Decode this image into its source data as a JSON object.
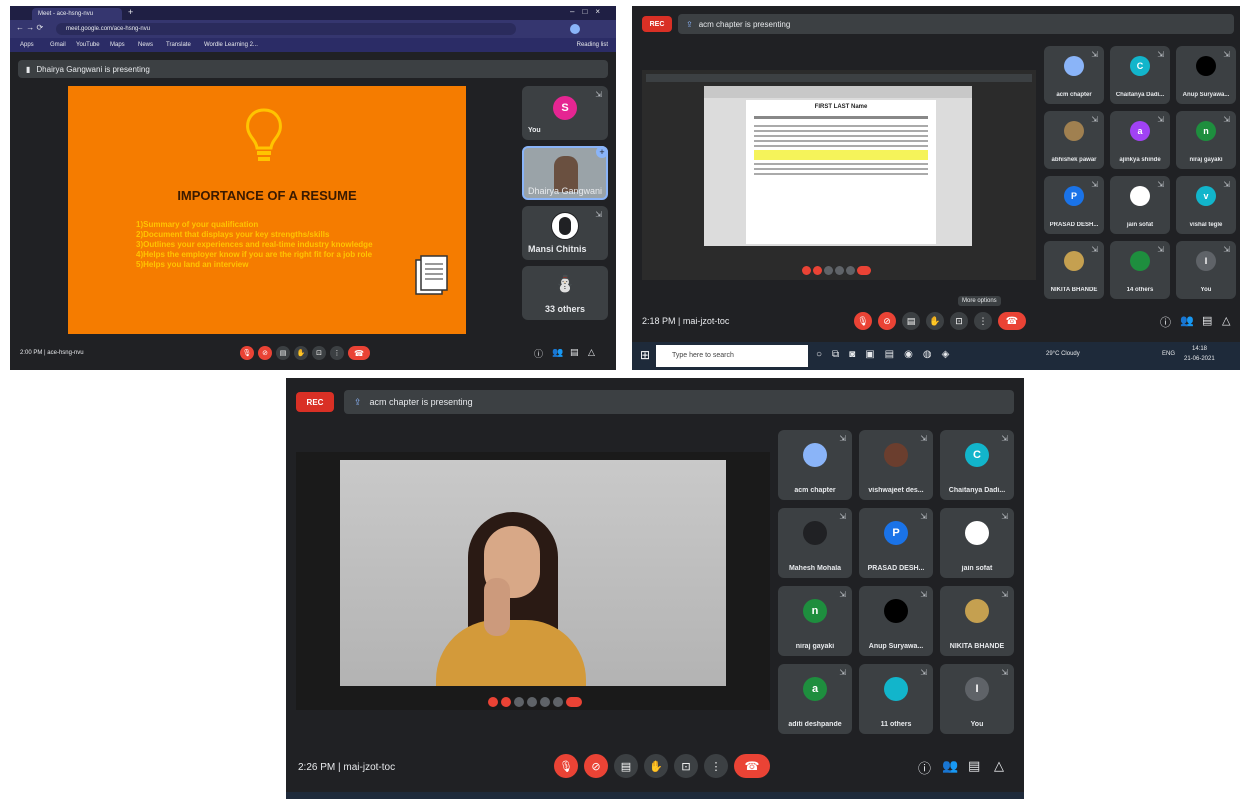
{
  "shot1": {
    "browser_tab": "Meet - ace-hsng-nvu",
    "url": "meet.google.com/ace-hsng-nvu",
    "bookmarks": [
      "Apps",
      "Gmail",
      "YouTube",
      "Maps",
      "News",
      "Translate",
      "Wordle Learning 2..."
    ],
    "reading_list": "Reading list",
    "presenter_banner": "Dhairya Gangwani is presenting",
    "slide": {
      "title": "IMPORTANCE OF A RESUME",
      "points": [
        "1)Summary of your qualification",
        "2)Document that displays your key strengths/skills",
        "3)Outlines your experiences and real-time industry knowledge",
        "4)Helps the employer know if you are the right fit for a job role",
        "5)Helps you land an interview"
      ]
    },
    "tiles": [
      {
        "name": "You",
        "initial": "S",
        "color": "#e52592"
      },
      {
        "name": "Dhairya Gangwani",
        "initial": "",
        "color": "#5f6368"
      },
      {
        "name": "Mansi Chitnis",
        "initial": "",
        "color": "#ffffff"
      },
      {
        "name": "33 others",
        "initial": "",
        "color": "#8ab4f8"
      }
    ],
    "time": "2:00 PM",
    "meeting_code": "ace-hsng-nvu"
  },
  "shot2": {
    "rec": "REC",
    "presenting": "acm chapter is presenting",
    "doc_title": "FIRST LAST Name",
    "tiles": [
      {
        "name": "acm chapter",
        "initial": "",
        "color": "#8ab4f8"
      },
      {
        "name": "Chaitanya Dadi...",
        "initial": "C",
        "color": "#12b5cb"
      },
      {
        "name": "Anup Suryawa...",
        "initial": "",
        "color": "#000000"
      },
      {
        "name": "abhishek pawar",
        "initial": "",
        "color": "#a08050"
      },
      {
        "name": "ajinkya shinde",
        "initial": "a",
        "color": "#a142f4"
      },
      {
        "name": "niraj gayaki",
        "initial": "n",
        "color": "#1e8e3e"
      },
      {
        "name": "PRASAD DESH...",
        "initial": "P",
        "color": "#1a73e8"
      },
      {
        "name": "jain sofat",
        "initial": "",
        "color": "#ffffff"
      },
      {
        "name": "vishal tegle",
        "initial": "v",
        "color": "#12b5cb"
      },
      {
        "name": "NIKITA BHANDE",
        "initial": "",
        "color": "#c5a050"
      },
      {
        "name": "14 others",
        "initial": "",
        "color": "#1e8e3e"
      },
      {
        "name": "You",
        "initial": "I",
        "color": "#5f6368"
      }
    ],
    "tooltip": "More options",
    "time": "2:18 PM",
    "meeting_code": "mai-jzot-toc",
    "taskbar_search": "Type here to search",
    "weather": "29°C Cloudy",
    "clock": "14:18",
    "date": "21-06-2021",
    "lang": "ENG"
  },
  "shot3": {
    "rec": "REC",
    "presenting": "acm chapter is presenting",
    "tiles": [
      {
        "name": "acm chapter",
        "initial": "",
        "color": "#8ab4f8"
      },
      {
        "name": "vishwajeet des...",
        "initial": "",
        "color": "#6b3e2e"
      },
      {
        "name": "Chaitanya Dadi...",
        "initial": "C",
        "color": "#12b5cb"
      },
      {
        "name": "Mahesh Mohala",
        "initial": "",
        "color": "#202124"
      },
      {
        "name": "PRASAD DESH...",
        "initial": "P",
        "color": "#1a73e8"
      },
      {
        "name": "jain sofat",
        "initial": "",
        "color": "#ffffff"
      },
      {
        "name": "niraj gayaki",
        "initial": "n",
        "color": "#1e8e3e"
      },
      {
        "name": "Anup Suryawa...",
        "initial": "",
        "color": "#000000"
      },
      {
        "name": "NIKITA BHANDE",
        "initial": "",
        "color": "#c5a050"
      },
      {
        "name": "aditi deshpande",
        "initial": "a",
        "color": "#1e8e3e"
      },
      {
        "name": "11 others",
        "initial": "",
        "color": "#12b5cb"
      },
      {
        "name": "You",
        "initial": "I",
        "color": "#5f6368"
      }
    ],
    "time": "2:26 PM",
    "meeting_code": "mai-jzot-toc"
  },
  "colors": {
    "meet_bg": "#202124",
    "tile_bg": "#3c4043",
    "end_call": "#ea4335",
    "slide_orange": "#f57c00",
    "slide_yellow": "#ffc400"
  }
}
